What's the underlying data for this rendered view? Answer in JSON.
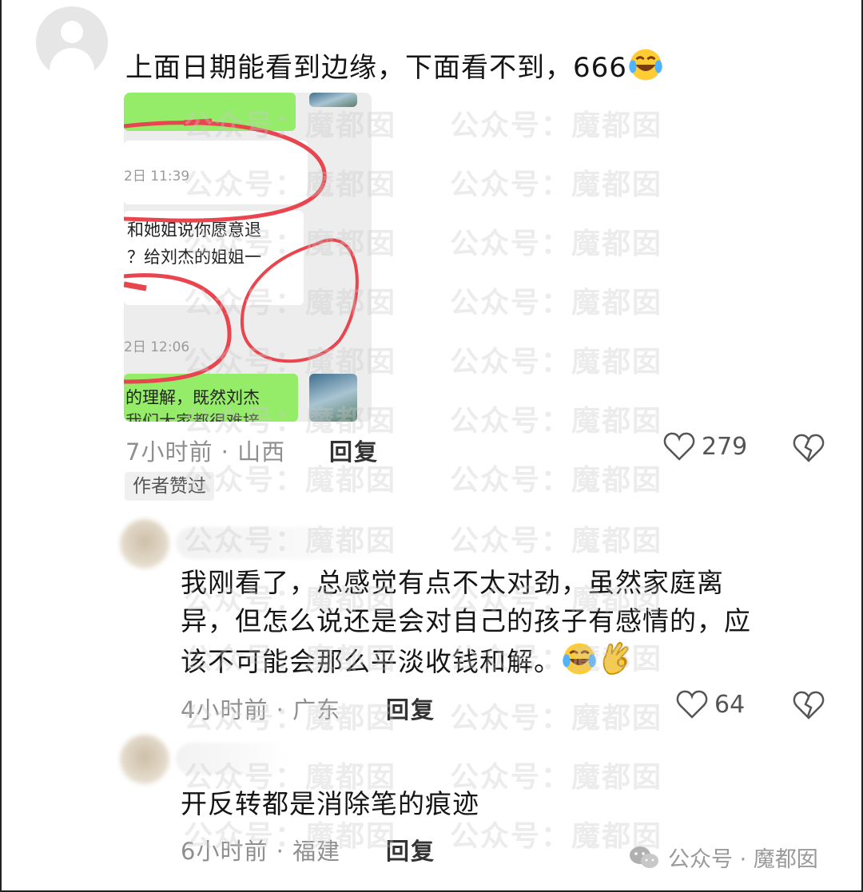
{
  "comments": [
    {
      "text_line": "上面日期能看到边缘，下面看不到，666",
      "meta": "7小时前 · 山西",
      "reply_label": "回复",
      "likes": "279",
      "badge": "作者赞过",
      "screenshot": {
        "time1": "2日 11:39",
        "msg1_line1": "和她姐说你愿意退",
        "msg1_line2": "？给刘杰的姐姐一",
        "time2": "2日 12:06",
        "msg2_line1": "的理解，既然刘杰",
        "msg2_line2": "我们大家都很难接"
      }
    },
    {
      "lines": [
        "我刚看了，总感觉有点不太对劲，虽然家庭离",
        "异，但怎么说还是会对自己的孩子有感情的，应",
        "该不可能会那么平淡收钱和解。"
      ],
      "meta": "4小时前 · 广东",
      "reply_label": "回复",
      "likes": "64"
    },
    {
      "text": "开反转都是消除笔的痕迹",
      "meta": "6小时前 · 福建",
      "reply_label": "回复"
    }
  ],
  "watermark": "公众号：魔都囡",
  "footer": {
    "label": "公众号 · 魔都囡"
  },
  "colors": {
    "wechat_green": "#95ec69",
    "red_marker": "#e8454f"
  }
}
